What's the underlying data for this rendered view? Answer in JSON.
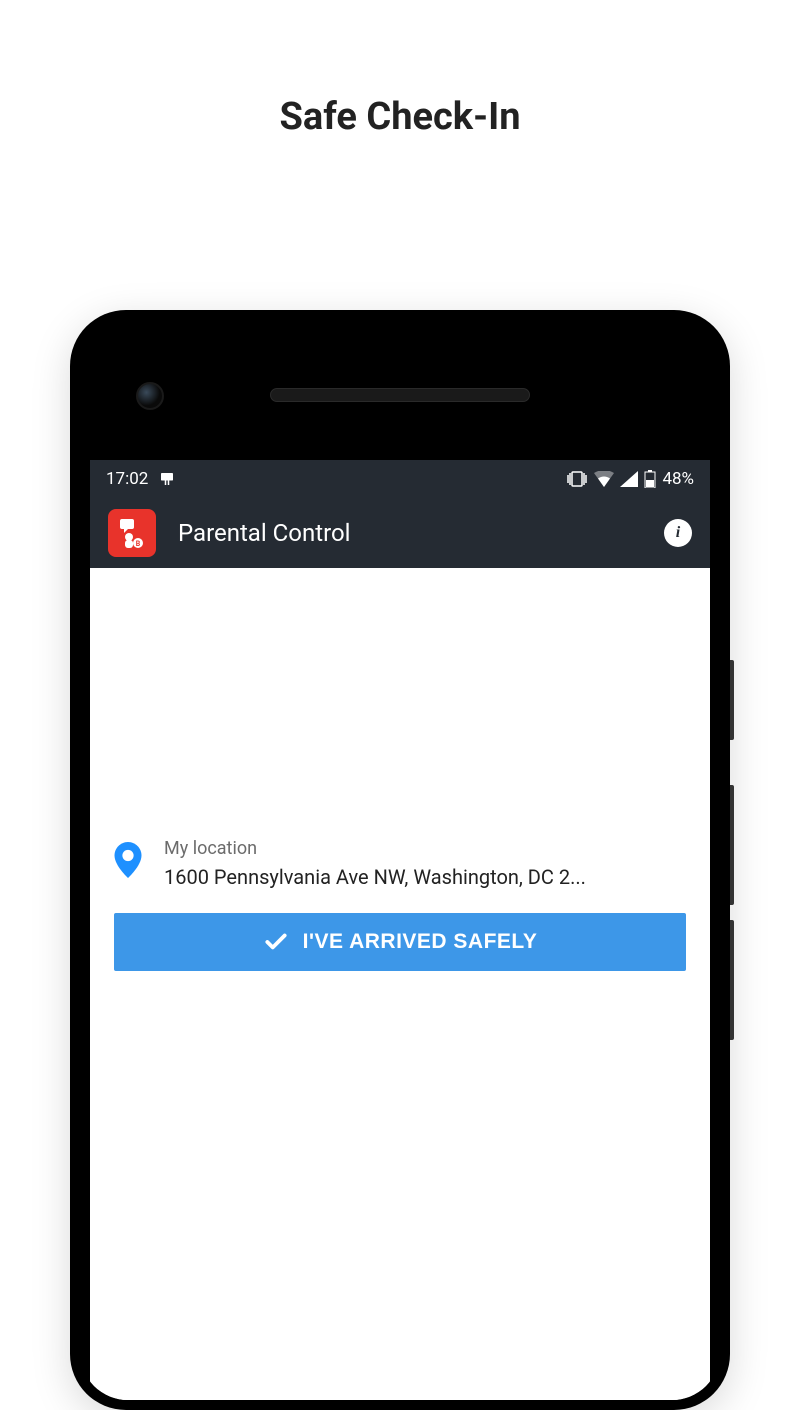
{
  "page": {
    "title": "Safe Check-In"
  },
  "status_bar": {
    "time": "17:02",
    "battery_percent": "48%"
  },
  "app_bar": {
    "title": "Parental Control"
  },
  "location": {
    "label": "My location",
    "address": "1600 Pennsylvania Ave NW, Washington, DC 2..."
  },
  "button": {
    "arrived_label": "I'VE ARRIVED SAFELY"
  },
  "colors": {
    "accent": "#3d97e8",
    "app_icon": "#e8332b",
    "dark_bar": "#252b33"
  }
}
